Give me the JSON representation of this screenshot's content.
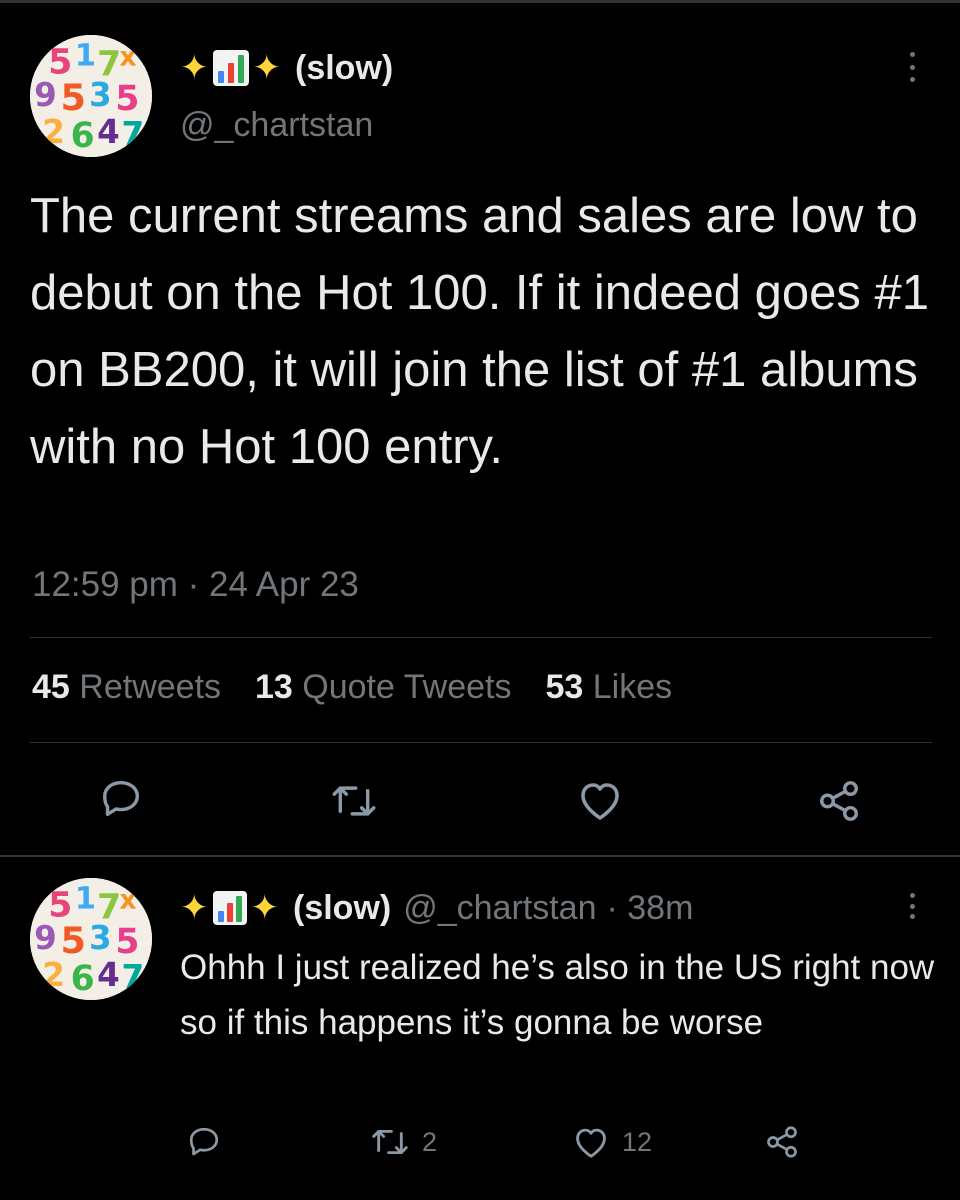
{
  "main_tweet": {
    "display_name": "(slow)",
    "handle": "@_chartstan",
    "text": "The current streams and sales are low to debut on the Hot 100. If it indeed goes #1 on BB200, it will join the list of #1 albums with no Hot 100 entry.",
    "timestamp": "12:59 pm · 24 Apr 23",
    "stats": {
      "retweets_count": "45",
      "retweets_label": "Retweets",
      "quotes_count": "13",
      "quotes_label": "Quote Tweets",
      "likes_count": "53",
      "likes_label": "Likes"
    }
  },
  "reply": {
    "display_name": "(slow)",
    "handle": "@_chartstan",
    "time": "· 38m",
    "text": "Ohhh I just realized he’s also in the US right now so if this happens it’s gonna be worse",
    "retweet_count": "2",
    "like_count": "12"
  },
  "icons": {
    "name_prefix": [
      "sparkles-icon",
      "bar-chart-icon",
      "sparkles-icon"
    ],
    "actions": [
      "reply-icon",
      "retweet-icon",
      "like-icon",
      "share-icon"
    ],
    "menu": "more-options-icon"
  },
  "colors": {
    "background": "#000000",
    "text_primary": "#e7e9ea",
    "text_secondary": "#71767b",
    "divider": "#2f3336",
    "sparkle": "#ffd43b"
  }
}
